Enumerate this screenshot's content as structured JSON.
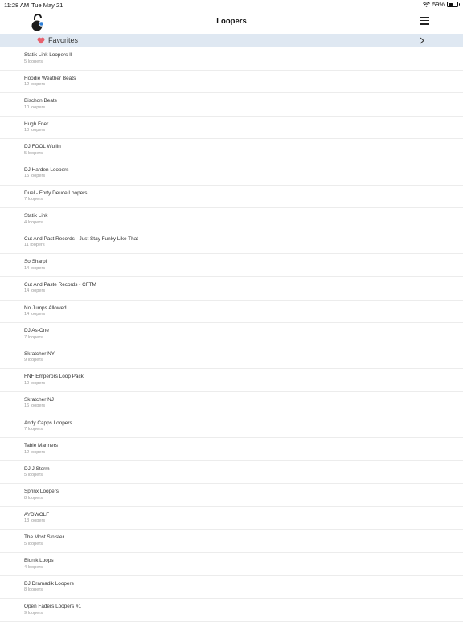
{
  "status_bar": {
    "time": "11:28 AM",
    "date": "Tue May 21",
    "battery_text": "59%",
    "battery_level": 0.59,
    "icons": [
      "wifi-icon",
      "battery-icon"
    ]
  },
  "nav": {
    "title": "Loopers",
    "logo_icon": "open-padlock-logo",
    "menu_icon": "hamburger-menu-icon"
  },
  "favorites": {
    "label": "Favorites",
    "icon": "heart-icon",
    "chevron_icon": "chevron-right-icon",
    "background": "#dfe8f2",
    "heart_color": "#e8616e"
  },
  "colors": {
    "logo_dark": "#1a1a1a",
    "logo_accent": "#2f7fd6",
    "divider": "#ececec",
    "secondary_text": "#9a9a9a"
  },
  "loopers": [
    {
      "name": "Statik Link Loopers II",
      "count": "5 loopers"
    },
    {
      "name": "Hoodie Weather Beats",
      "count": "12 loopers"
    },
    {
      "name": "Bischon Beats",
      "count": "10 loopers"
    },
    {
      "name": "Hugh Fner",
      "count": "10 loopers"
    },
    {
      "name": "DJ FOOL Wullin",
      "count": "5 loopers"
    },
    {
      "name": "DJ Harden Loopers",
      "count": "15 loopers"
    },
    {
      "name": "Duel - Forty Deuce Loopers",
      "count": "7 loopers"
    },
    {
      "name": "Statik Link",
      "count": "4 loopers"
    },
    {
      "name": "Cut And Past Records - Just Stay Funky Like That",
      "count": "11 loopers"
    },
    {
      "name": "So Sharpl",
      "count": "14 loopers"
    },
    {
      "name": "Cut And Paste Records - CFTM",
      "count": "14 loopers"
    },
    {
      "name": "No Jumps Allowed",
      "count": "14 loopers"
    },
    {
      "name": "DJ As-One",
      "count": "7 loopers"
    },
    {
      "name": "Skratcher NY",
      "count": "9 loopers"
    },
    {
      "name": "FNF Emperors Loop Pack",
      "count": "10 loopers"
    },
    {
      "name": "Skratcher NJ",
      "count": "16 loopers"
    },
    {
      "name": "Andy Capps Loopers",
      "count": "7 loopers"
    },
    {
      "name": "Table Manners",
      "count": "12 loopers"
    },
    {
      "name": "DJ J Storm",
      "count": "5 loopers"
    },
    {
      "name": "Sphnx Loopers",
      "count": "8 loopers"
    },
    {
      "name": "AYDWOLF",
      "count": "13 loopers"
    },
    {
      "name": "The.Most.Sinister",
      "count": "5 loopers"
    },
    {
      "name": "Bionik Loops",
      "count": "4 loopers"
    },
    {
      "name": "DJ Dramadik Loopers",
      "count": "8 loopers"
    },
    {
      "name": "Open Faders Loopers #1",
      "count": "9 loopers"
    }
  ]
}
